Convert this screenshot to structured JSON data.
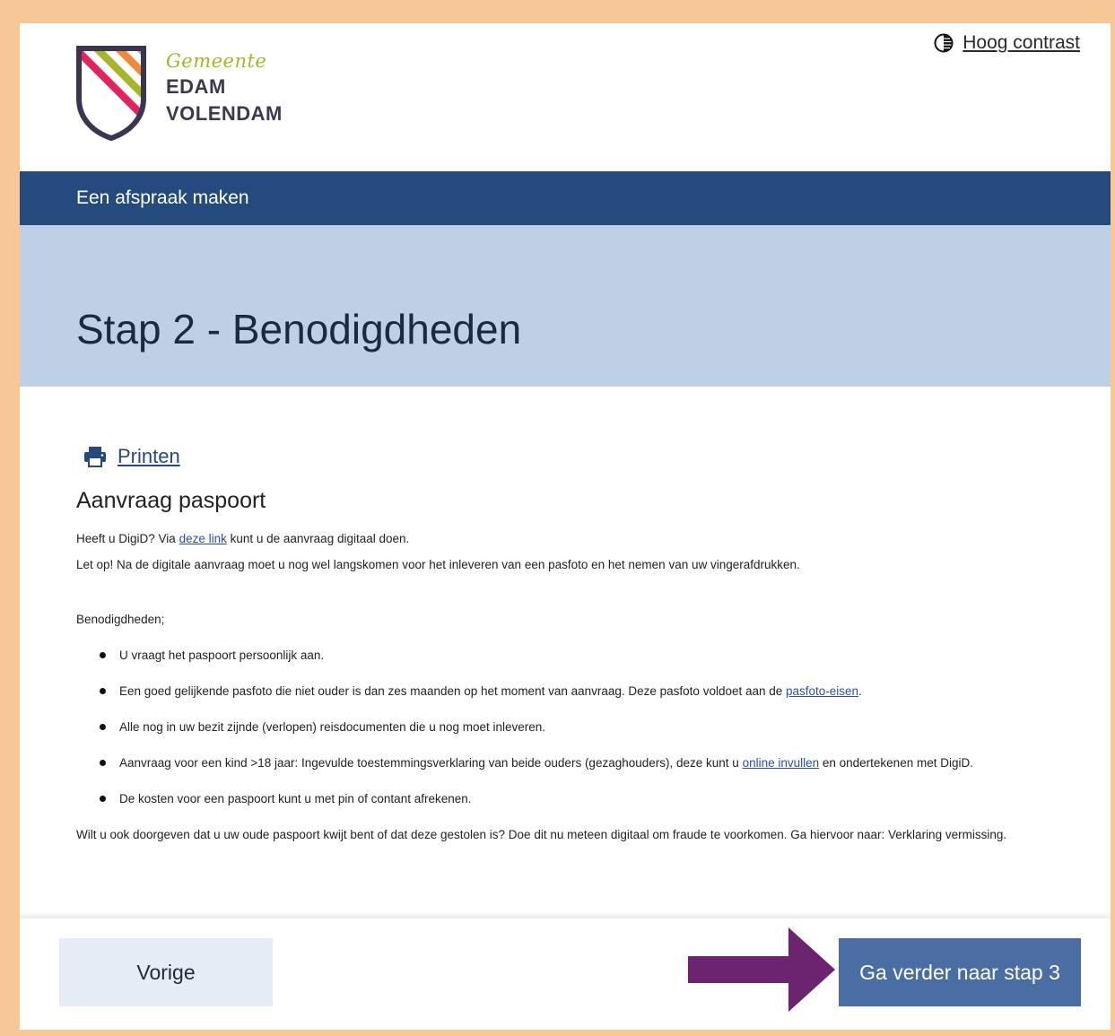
{
  "header": {
    "logo": {
      "line1": "Gemeente",
      "line2": "EDAM",
      "line3": "VOLENDAM"
    },
    "contrast_link": "Hoog contrast"
  },
  "nav": {
    "title": "Een afspraak maken"
  },
  "page": {
    "title": "Stap 2 - Benodigdheden"
  },
  "content": {
    "print_link": "Printen",
    "section_title": "Aanvraag paspoort",
    "intro": {
      "before_link": "Heeft u DigiD? Via ",
      "link": "deze link",
      "after_link": " kunt u de aanvraag digitaal doen."
    },
    "notice": "Let op! Na de digitale aanvraag moet u nog wel langskomen voor het inleveren van een pasfoto en het nemen van uw vingerafdrukken.",
    "requirements_label": "Benodigdheden;",
    "bullets": [
      {
        "text": "U vraagt het paspoort persoonlijk aan."
      },
      {
        "before": "Een goed gelijkende pasfoto die niet ouder is dan zes maanden op het moment van aanvraag. Deze pasfoto voldoet aan de ",
        "link": "pasfoto-eisen",
        "after": "."
      },
      {
        "text": "Alle nog in uw bezit zijnde (verlopen) reisdocumenten die u nog moet inleveren."
      },
      {
        "before": "Aanvraag voor een kind >18 jaar: Ingevulde toestemmingsverklaring van beide ouders (gezaghouders), deze kunt u ",
        "link": "online invullen",
        "after": " en ondertekenen met DigiD."
      },
      {
        "text": "De kosten voor een paspoort kunt u met pin of contant afrekenen."
      }
    ],
    "footer_note": {
      "before": "Wilt u ook doorgeven dat u uw oude paspoort kwijt bent of dat deze gestolen is? Doe dit nu meteen digitaal om fraude te voorkomen. Ga hiervoor naar: ",
      "link": "Verklaring vermissing",
      "after": "."
    }
  },
  "footer": {
    "prev_label": "Vorige",
    "next_label": "Ga verder naar stap 3"
  },
  "colors": {
    "nav_band": "#244a7e",
    "title_band": "#bfcfe5",
    "next_button": "#4a6ea3",
    "prev_button": "#e6ecf6",
    "arrow": "#6c2470",
    "outer_frame": "#f7c896"
  },
  "icons": {
    "contrast": "contrast-icon",
    "print": "printer-icon",
    "logo": "shield-logo-icon",
    "arrow": "arrow-right-icon"
  }
}
